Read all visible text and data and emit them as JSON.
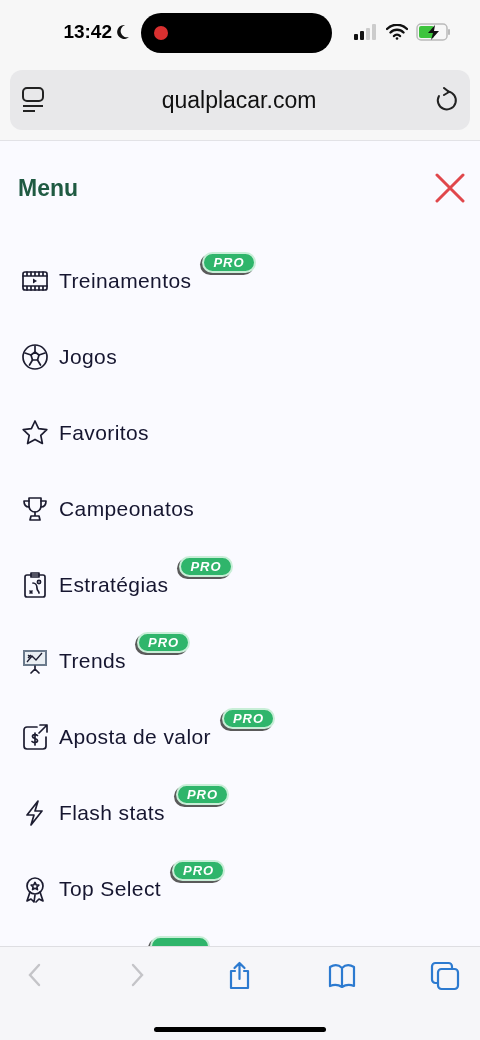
{
  "status_bar": {
    "time": "13:42",
    "recording": true
  },
  "address_bar": {
    "url": "qualplacar.com"
  },
  "menu": {
    "title": "Menu",
    "items": [
      {
        "kind": "film",
        "label": "Treinamentos",
        "pro": true,
        "badge": "PRO"
      },
      {
        "kind": "ball",
        "label": "Jogos",
        "pro": false
      },
      {
        "kind": "star",
        "label": "Favoritos",
        "pro": false
      },
      {
        "kind": "trophy",
        "label": "Campeonatos",
        "pro": false
      },
      {
        "kind": "clipboard",
        "label": "Estratégias",
        "pro": true,
        "badge": "PRO"
      },
      {
        "kind": "presentation",
        "label": "Trends",
        "pro": true,
        "badge": "PRO"
      },
      {
        "kind": "dollar",
        "label": "Aposta de valor",
        "pro": true,
        "badge": "PRO"
      },
      {
        "kind": "bolt",
        "label": "Flash stats",
        "pro": true,
        "badge": "PRO"
      },
      {
        "kind": "medal",
        "label": "Top Select",
        "pro": true,
        "badge": "PRO"
      },
      {
        "kind": "hidden",
        "pro": true
      }
    ]
  },
  "toolbar": [
    {
      "kind": "back",
      "disabled": true
    },
    {
      "kind": "forward",
      "disabled": true
    },
    {
      "kind": "share",
      "disabled": false
    },
    {
      "kind": "bookmarks",
      "disabled": false
    },
    {
      "kind": "tabs",
      "disabled": false
    }
  ]
}
